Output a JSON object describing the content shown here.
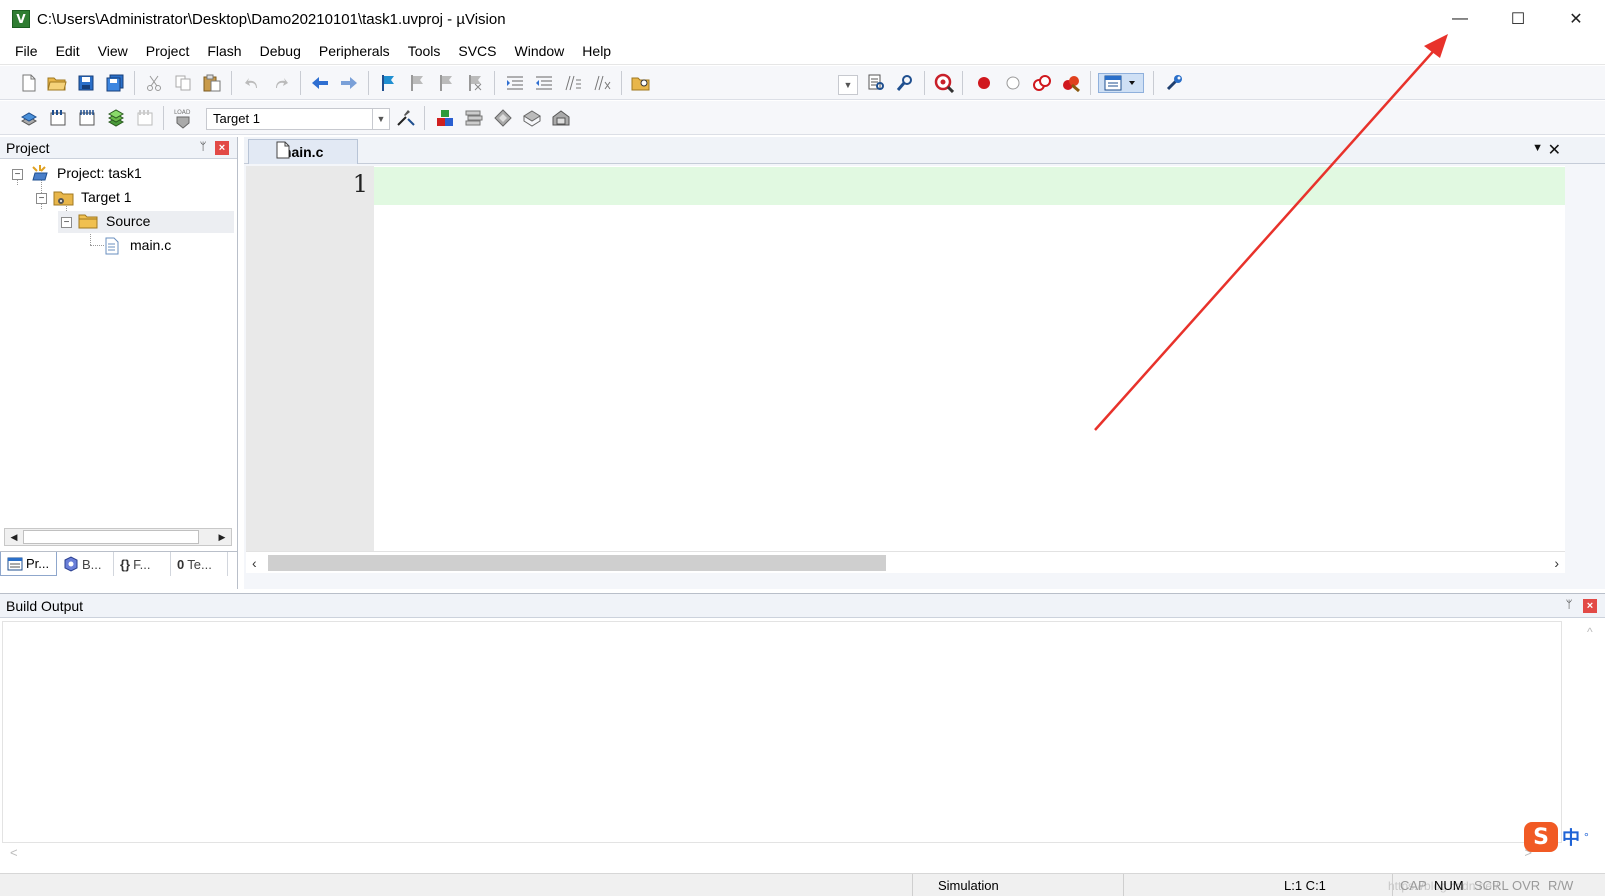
{
  "window": {
    "title": "C:\\Users\\Administrator\\Desktop\\Damo20210101\\task1.uvproj - µVision",
    "app_icon_letter": "V",
    "controls": {
      "minimize": "—",
      "maximize": "☐",
      "close": "✕"
    }
  },
  "menu": [
    "File",
    "Edit",
    "View",
    "Project",
    "Flash",
    "Debug",
    "Peripherals",
    "Tools",
    "SVCS",
    "Window",
    "Help"
  ],
  "toolbar2": {
    "target": "Target 1",
    "dropdown_arrow": "▼"
  },
  "project_panel": {
    "title": "Project",
    "pin": "ᛘ",
    "close": "×",
    "tree": [
      {
        "label": "Project: task1",
        "expander": "−"
      },
      {
        "label": "Target 1",
        "expander": "−"
      },
      {
        "label": "Source",
        "expander": "−"
      },
      {
        "label": "main.c"
      }
    ],
    "scroll_left": "◀",
    "scroll_right": "▶",
    "tabs": [
      {
        "label": "Pr..."
      },
      {
        "label": "B..."
      },
      {
        "label": "F..."
      },
      {
        "label": "Te..."
      }
    ],
    "tab_glyphs": {
      "functions": "{}",
      "templates": "0"
    }
  },
  "editor": {
    "tabs": [
      {
        "label": "main.c"
      }
    ],
    "tab_list_glyph": "▼",
    "tab_close_glyph": "✕",
    "line_numbers": [
      "1"
    ],
    "scroll_left": "‹",
    "scroll_right": "›"
  },
  "build_output": {
    "title": "Build Output",
    "pin": "ᛘ",
    "close": "×",
    "scroll_up": "^",
    "scroll_left": "<",
    "scroll_right": ">"
  },
  "ime": {
    "logo": "S",
    "mode": "中",
    "dot": "°"
  },
  "status": {
    "mode": "Simulation",
    "position": "L:1 C:1",
    "indicators": [
      "CAP",
      "NUM",
      "SCRL",
      "OVR",
      "R/W"
    ],
    "active_indicator": "NUM",
    "watermark": "https://blog.csdn.net/..."
  },
  "colors": {
    "current_line": "#e1f9e1",
    "arrow": "#e8322b",
    "panel_close": "#e24a46"
  }
}
